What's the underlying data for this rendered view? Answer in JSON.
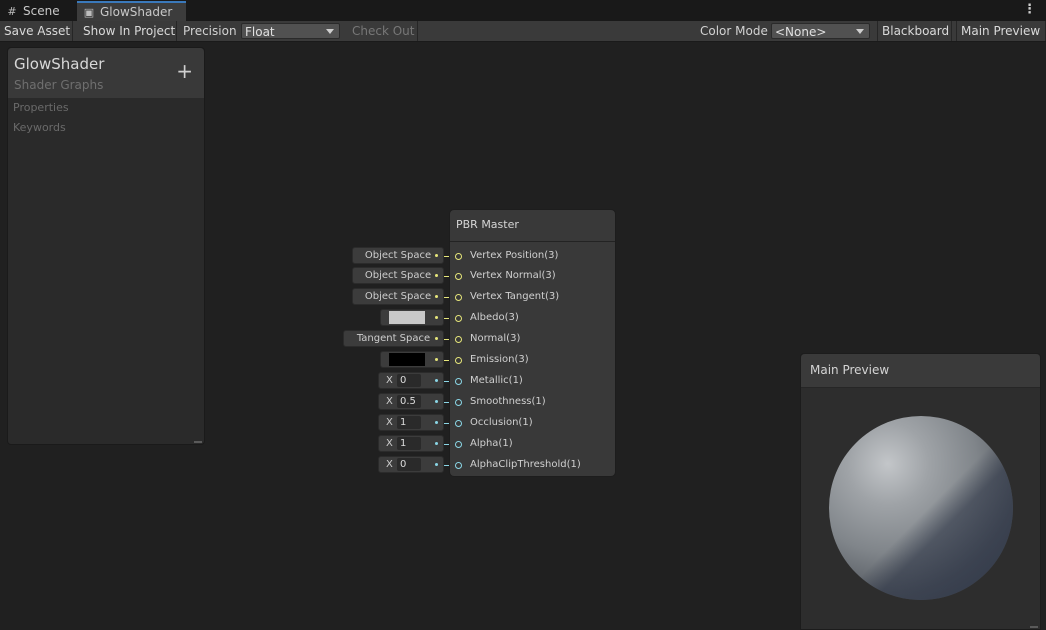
{
  "tabs": [
    {
      "label": "Scene",
      "icon": "grid-icon"
    },
    {
      "label": "GlowShader",
      "icon": "shader-graph-icon"
    }
  ],
  "toolbar": {
    "save_asset": "Save Asset",
    "show_in_project": "Show In Project",
    "precision_label": "Precision",
    "precision_value": "Float",
    "check_out": "Check Out",
    "color_mode_label": "Color Mode",
    "color_mode_value": "<None>",
    "blackboard": "Blackboard",
    "main_preview": "Main Preview"
  },
  "blackboard": {
    "title": "GlowShader",
    "subtitle": "Shader Graphs",
    "add_icon": "+",
    "sections": [
      "Properties",
      "Keywords"
    ]
  },
  "node": {
    "title": "PBR Master",
    "ports": [
      {
        "label": "Vertex Position(3)",
        "input": {
          "kind": "space",
          "text": "Object Space"
        },
        "port_color": "#e6e67a"
      },
      {
        "label": "Vertex Normal(3)",
        "input": {
          "kind": "space",
          "text": "Object Space"
        },
        "port_color": "#e6e67a"
      },
      {
        "label": "Vertex Tangent(3)",
        "input": {
          "kind": "space",
          "text": "Object Space"
        },
        "port_color": "#e6e67a"
      },
      {
        "label": "Albedo(3)",
        "input": {
          "kind": "color",
          "color": "#c9c9c9"
        },
        "port_color": "#e6e67a"
      },
      {
        "label": "Normal(3)",
        "input": {
          "kind": "space",
          "text": "Tangent Space"
        },
        "port_color": "#e6e67a"
      },
      {
        "label": "Emission(3)",
        "input": {
          "kind": "color",
          "color": "#000000"
        },
        "port_color": "#e6e67a"
      },
      {
        "label": "Metallic(1)",
        "input": {
          "kind": "float",
          "axis": "X",
          "value": "0"
        },
        "port_color": "#8ad6e6"
      },
      {
        "label": "Smoothness(1)",
        "input": {
          "kind": "float",
          "axis": "X",
          "value": "0.5"
        },
        "port_color": "#8ad6e6"
      },
      {
        "label": "Occlusion(1)",
        "input": {
          "kind": "float",
          "axis": "X",
          "value": "1"
        },
        "port_color": "#8ad6e6"
      },
      {
        "label": "Alpha(1)",
        "input": {
          "kind": "float",
          "axis": "X",
          "value": "1"
        },
        "port_color": "#8ad6e6"
      },
      {
        "label": "AlphaClipThreshold(1)",
        "input": {
          "kind": "float",
          "axis": "X",
          "value": "0"
        },
        "port_color": "#8ad6e6"
      }
    ]
  },
  "preview": {
    "title": "Main Preview"
  }
}
